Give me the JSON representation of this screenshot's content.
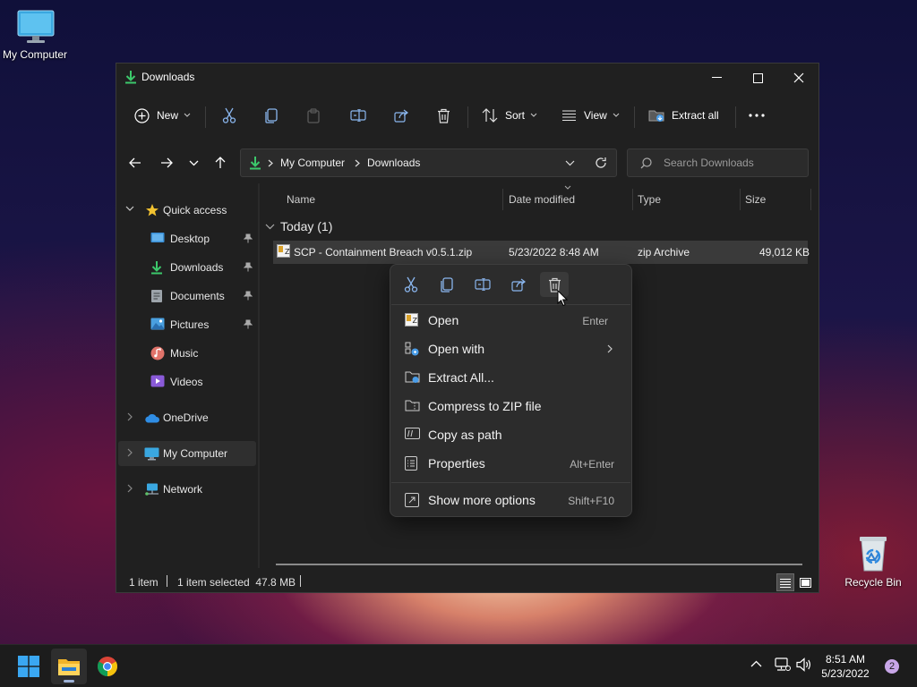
{
  "desktop": {
    "icons": [
      {
        "label": "My Computer"
      },
      {
        "label": "Recycle Bin"
      }
    ]
  },
  "window": {
    "title": "Downloads",
    "controls": {
      "minimize": "minimize",
      "maximize": "maximize",
      "close": "close"
    }
  },
  "toolbar": {
    "new_label": "New",
    "sort_label": "Sort",
    "view_label": "View",
    "extract_all_label": "Extract all"
  },
  "address": {
    "path": [
      "My Computer",
      "Downloads"
    ],
    "search_placeholder": "Search Downloads"
  },
  "navigation": {
    "quick_access_label": "Quick access",
    "quick_items": [
      {
        "label": "Desktop",
        "icon": "desktop-folder-icon",
        "pinned": true
      },
      {
        "label": "Downloads",
        "icon": "downloads-folder-icon",
        "pinned": true
      },
      {
        "label": "Documents",
        "icon": "documents-folder-icon",
        "pinned": true
      },
      {
        "label": "Pictures",
        "icon": "pictures-folder-icon",
        "pinned": true
      },
      {
        "label": "Music",
        "icon": "music-folder-icon",
        "pinned": false
      },
      {
        "label": "Videos",
        "icon": "videos-folder-icon",
        "pinned": false
      }
    ],
    "onedrive_label": "OneDrive",
    "my_computer_label": "My Computer",
    "network_label": "Network"
  },
  "file_list": {
    "columns": {
      "name": "Name",
      "date": "Date modified",
      "type": "Type",
      "size": "Size"
    },
    "group_label": "Today (1)",
    "files": [
      {
        "name": "SCP - Containment Breach v0.5.1.zip",
        "date": "5/23/2022 8:48 AM",
        "type": "zip Archive",
        "size": "49,012 KB"
      }
    ]
  },
  "status": {
    "count": "1 item",
    "selection": "1 item selected  47.8 MB"
  },
  "context_menu": {
    "items": [
      {
        "label": "Open",
        "shortcut": "Enter",
        "icon": "zip-archive-icon"
      },
      {
        "label": "Open with",
        "shortcut": "",
        "icon": "open-with-icon",
        "submenu": true
      },
      {
        "label": "Extract All...",
        "shortcut": "",
        "icon": "extract-icon"
      },
      {
        "label": "Compress to ZIP file",
        "shortcut": "",
        "icon": "compress-zip-icon"
      },
      {
        "label": "Copy as path",
        "shortcut": "",
        "icon": "copy-path-icon"
      },
      {
        "label": "Properties",
        "shortcut": "Alt+Enter",
        "icon": "properties-icon"
      }
    ],
    "more_options": {
      "label": "Show more options",
      "shortcut": "Shift+F10",
      "icon": "show-more-icon"
    }
  },
  "taskbar": {
    "time": "8:51 AM",
    "date": "5/23/2022",
    "notification_count": "2"
  },
  "colors": {
    "accent_download": "#3cc86b",
    "window_bg": "#202020",
    "menu_bg": "#2c2c2c",
    "selected_row": "#3a3a3a"
  }
}
